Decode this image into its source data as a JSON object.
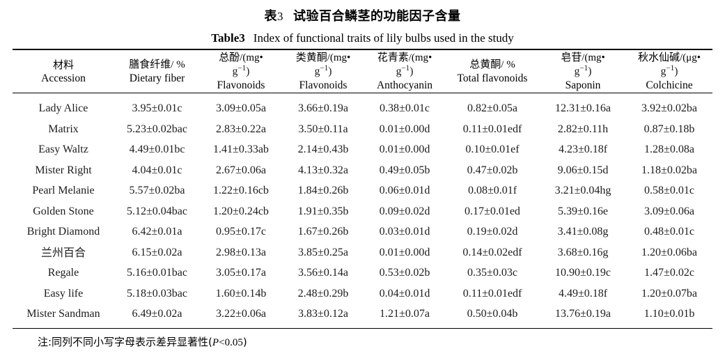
{
  "title": {
    "cn_label": "表",
    "cn_number": "3",
    "cn_text": "试验百合鳞茎的功能因子含量",
    "en_label": "Table3",
    "en_text": "Index of functional traits of lily bulbs used in the study"
  },
  "columns": [
    {
      "cn": "材料",
      "cn_unit": "",
      "unit_line2": "",
      "en": "Accession"
    },
    {
      "cn": "膳食纤维",
      "cn_unit": "/ %",
      "unit_line2": "",
      "en": "Dietary fiber"
    },
    {
      "cn": "总酚",
      "cn_unit": "/(mg•",
      "unit_line2": "g−1)",
      "en": "Flavonoids"
    },
    {
      "cn": "类黄酮",
      "cn_unit": "/(mg•",
      "unit_line2": "g−1)",
      "en": "Flavonoids"
    },
    {
      "cn": "花青素",
      "cn_unit": "/(mg•",
      "unit_line2": "g−1)",
      "en": "Anthocyanin"
    },
    {
      "cn": "总黄酮",
      "cn_unit": "/ %",
      "unit_line2": "",
      "en": "Total flavonoids"
    },
    {
      "cn": "皂苷",
      "cn_unit": "/(mg•",
      "unit_line2": "g−1)",
      "en": "Saponin"
    },
    {
      "cn": "秋水仙碱",
      "cn_unit": "/(μg•",
      "unit_line2": "g−1)",
      "en": "Colchicine"
    }
  ],
  "rows": [
    {
      "accession": "Lady Alice",
      "is_cjk": false,
      "values": [
        "3.95±0.01c",
        "3.09±0.05a",
        "3.66±0.19a",
        "0.38±0.01c",
        "0.82±0.05a",
        "12.31±0.16a",
        "3.92±0.02ba"
      ]
    },
    {
      "accession": "Matrix",
      "is_cjk": false,
      "values": [
        "5.23±0.02bac",
        "2.83±0.22a",
        "3.50±0.11a",
        "0.01±0.00d",
        "0.11±0.01edf",
        "2.82±0.11h",
        "0.87±0.18b"
      ]
    },
    {
      "accession": "Easy Waltz",
      "is_cjk": false,
      "values": [
        "4.49±0.01bc",
        "1.41±0.33ab",
        "2.14±0.43b",
        "0.01±0.00d",
        "0.10±0.01ef",
        "4.23±0.18f",
        "1.28±0.08a"
      ]
    },
    {
      "accession": "Mister Right",
      "is_cjk": false,
      "values": [
        "4.04±0.01c",
        "2.67±0.06a",
        "4.13±0.32a",
        "0.49±0.05b",
        "0.47±0.02b",
        "9.06±0.15d",
        "1.18±0.02ba"
      ]
    },
    {
      "accession": "Pearl Melanie",
      "is_cjk": false,
      "values": [
        "5.57±0.02ba",
        "1.22±0.16cb",
        "1.84±0.26b",
        "0.06±0.01d",
        "0.08±0.01f",
        "3.21±0.04hg",
        "0.58±0.01c"
      ]
    },
    {
      "accession": "Golden Stone",
      "is_cjk": false,
      "values": [
        "5.12±0.04bac",
        "1.20±0.24cb",
        "1.91±0.35b",
        "0.09±0.02d",
        "0.17±0.01ed",
        "5.39±0.16e",
        "3.09±0.06a"
      ]
    },
    {
      "accession": "Bright Diamond",
      "is_cjk": false,
      "values": [
        "6.42±0.01a",
        "0.95±0.17c",
        "1.67±0.26b",
        "0.03±0.01d",
        "0.19±0.02d",
        "3.41±0.08g",
        "0.48±0.01c"
      ]
    },
    {
      "accession": "兰州百合",
      "is_cjk": true,
      "values": [
        "6.15±0.02a",
        "2.98±0.13a",
        "3.85±0.25a",
        "0.01±0.00d",
        "0.14±0.02edf",
        "3.68±0.16g",
        "1.20±0.06ba"
      ]
    },
    {
      "accession": "Regale",
      "is_cjk": false,
      "values": [
        "5.16±0.01bac",
        "3.05±0.17a",
        "3.56±0.14a",
        "0.53±0.02b",
        "0.35±0.03c",
        "10.90±0.19c",
        "1.47±0.02c"
      ]
    },
    {
      "accession": "Easy life",
      "is_cjk": false,
      "values": [
        "5.18±0.03bac",
        "1.60±0.14b",
        "2.48±0.29b",
        "0.04±0.01d",
        "0.11±0.01edf",
        "4.49±0.18f",
        "1.20±0.07ba"
      ]
    },
    {
      "accession": "Mister Sandman",
      "is_cjk": false,
      "values": [
        "6.49±0.02a",
        "3.22±0.06a",
        "3.83±0.12a",
        "1.21±0.07a",
        "0.50±0.04b",
        "13.76±0.19a",
        "1.10±0.01b"
      ]
    }
  ],
  "note": {
    "prefix": "注:同列不同小写字母表示差异显著性(",
    "italic_p": "P",
    "operator": "<",
    "threshold": "0.05",
    "suffix": ")"
  }
}
